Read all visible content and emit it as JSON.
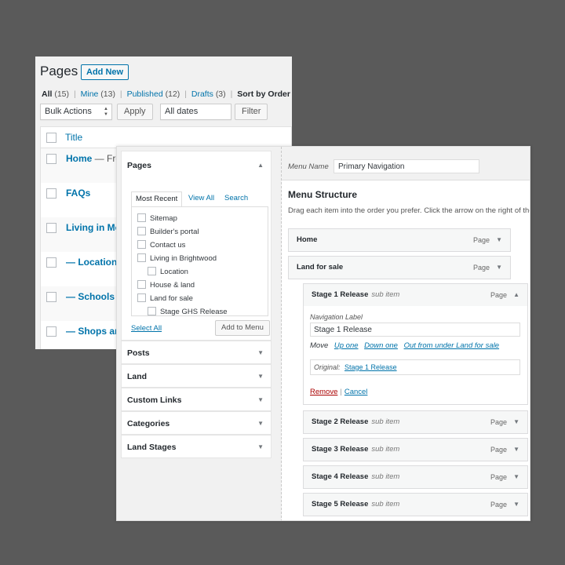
{
  "pages_screen": {
    "title": "Pages",
    "add_new": "Add New",
    "filters": {
      "all": "All",
      "all_count": "(15)",
      "mine": "Mine",
      "mine_count": "(13)",
      "published": "Published",
      "published_count": "(12)",
      "drafts": "Drafts",
      "drafts_count": "(3)",
      "sort": "Sort by Order"
    },
    "bulk_actions": "Bulk Actions",
    "apply": "Apply",
    "all_dates": "All dates",
    "filter": "Filter",
    "column_title": "Title",
    "rows": [
      {
        "title": "Home",
        "suffix": " — Fron"
      },
      {
        "title": "FAQs",
        "suffix": ""
      },
      {
        "title": "Living in Mos",
        "suffix": ""
      },
      {
        "title": "— Location",
        "suffix": ""
      },
      {
        "title": "— Schools",
        "suffix": ""
      },
      {
        "title": "— Shops and",
        "suffix": ""
      }
    ]
  },
  "menus_screen": {
    "left": {
      "pages_header": "Pages",
      "tabs": [
        "Most Recent",
        "View All",
        "Search"
      ],
      "page_items": [
        {
          "label": "Sitemap",
          "indent": 0
        },
        {
          "label": "Builder's portal",
          "indent": 0
        },
        {
          "label": "Contact us",
          "indent": 0
        },
        {
          "label": "Living in Brightwood",
          "indent": 0
        },
        {
          "label": "Location",
          "indent": 1
        },
        {
          "label": "House & land",
          "indent": 0
        },
        {
          "label": "Land for sale",
          "indent": 0
        },
        {
          "label": "Stage GHS Release",
          "indent": 1
        }
      ],
      "select_all": "Select All",
      "add_to_menu": "Add to Menu",
      "sections": [
        "Posts",
        "Land",
        "Custom Links",
        "Categories",
        "Land Stages"
      ]
    },
    "right": {
      "menu_name_label": "Menu Name",
      "menu_name_value": "Primary Navigation",
      "structure_title": "Menu Structure",
      "help_text": "Drag each item into the order you prefer. Click the arrow on the right of the",
      "items": [
        {
          "label": "Home",
          "sub": "",
          "type": "Page",
          "depth": 0
        },
        {
          "label": "Land for sale",
          "sub": "",
          "type": "Page",
          "depth": 0
        },
        {
          "label": "Stage 1 Release",
          "sub": "sub item",
          "type": "Page",
          "depth": 1
        },
        {
          "label": "Stage 2 Release",
          "sub": "sub item",
          "type": "Page",
          "depth": 1
        },
        {
          "label": "Stage 3 Release",
          "sub": "sub item",
          "type": "Page",
          "depth": 1
        },
        {
          "label": "Stage 4 Release",
          "sub": "sub item",
          "type": "Page",
          "depth": 1
        },
        {
          "label": "Stage 5 Release",
          "sub": "sub item",
          "type": "Page",
          "depth": 1
        }
      ],
      "expanded": {
        "nav_label_caption": "Navigation Label",
        "nav_label_value": "Stage 1 Release",
        "move_label": "Move",
        "move_links": [
          "Up one",
          "Down one",
          "Out from under Land for sale"
        ],
        "original_label": "Original:",
        "original_link": "Stage 1 Release",
        "remove": "Remove",
        "separator": "|",
        "cancel": "Cancel"
      }
    }
  },
  "icons": {
    "collapse": "triangle-up-icon",
    "expand": "triangle-down-icon",
    "select": "up-down-arrows-icon"
  },
  "colors": {
    "link": "#0073aa",
    "remove": "#aa0000",
    "backdrop": "#5a5a5a"
  }
}
